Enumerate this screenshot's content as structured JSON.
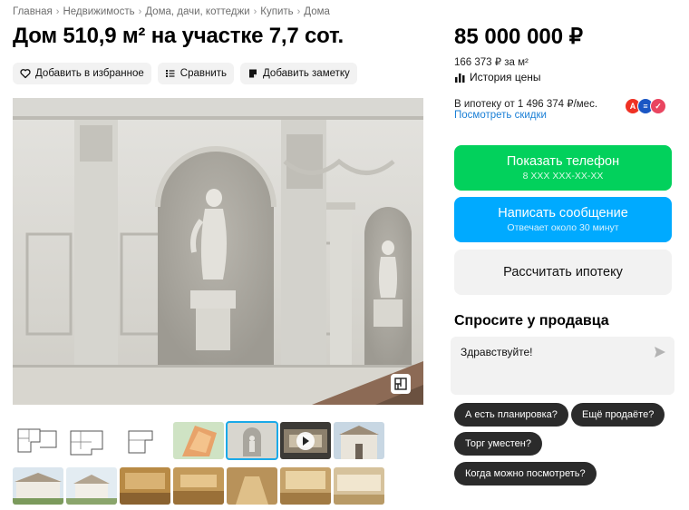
{
  "breadcrumb": [
    "Главная",
    "Недвижимость",
    "Дома, дачи, коттеджи",
    "Купить",
    "Дома"
  ],
  "title": "Дом 510,9 м² на участке 7,7 сот.",
  "actions": {
    "favorite": "Добавить в избранное",
    "compare": "Сравнить",
    "note": "Добавить заметку"
  },
  "price": {
    "total": "85 000 000 ₽",
    "per_sqm": "166 373 ₽ за м²",
    "history": "История цены"
  },
  "mortgage": {
    "text": "В ипотеку от 1 496 374 ₽/мес.",
    "discounts_link": "Посмотреть скидки",
    "bank_colors": [
      "#ef3124",
      "#1a56c4",
      "#e94560"
    ]
  },
  "buttons": {
    "phone_label": "Показать телефон",
    "phone_number": "8 XXX XXX-XX-XX",
    "message_label": "Написать сообщение",
    "message_sub": "Отвечает около 30 минут",
    "mortgage_calc": "Рассчитать ипотеку"
  },
  "ask": {
    "title": "Спросите у продавца",
    "input_value": "Здравствуйте!",
    "chips": [
      "А есть планировка?",
      "Ещё продаёте?",
      "Торг уместен?",
      "Когда можно посмотреть?"
    ]
  },
  "colors": {
    "green": "#02d15c",
    "blue": "#00aaff",
    "link": "#1a7fd6"
  }
}
